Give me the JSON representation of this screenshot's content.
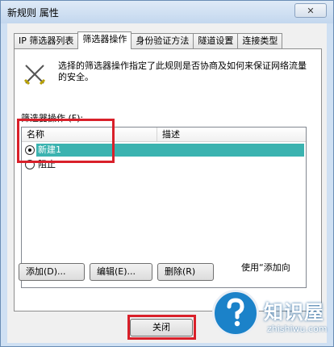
{
  "window": {
    "title": "新规则 属性",
    "close_glyph": "✕"
  },
  "tabs": [
    {
      "label": "IP 筛选器列表",
      "active": false
    },
    {
      "label": "筛选器操作",
      "active": true
    },
    {
      "label": "身份验证方法",
      "active": false
    },
    {
      "label": "隧道设置",
      "active": false
    },
    {
      "label": "连接类型",
      "active": false
    }
  ],
  "panel": {
    "icon": "crossed-swords-icon",
    "description": "选择的筛选器操作指定了此规则是否协商及如何来保证网络流量的安全。",
    "section_label": "筛选器操作 (F):"
  },
  "list": {
    "columns": [
      "名称",
      "描述"
    ],
    "rows": [
      {
        "name": "新建1",
        "description": "",
        "selected": true,
        "checked": true
      },
      {
        "name": "阻止",
        "description": "",
        "selected": false,
        "checked": false
      }
    ]
  },
  "buttons": {
    "add": "添加(D)...",
    "edit": "编辑(E)...",
    "delete": "删除(R)",
    "use_wizard": "使用“添加向",
    "close": "关闭"
  },
  "watermark": {
    "title": "知识屋",
    "subtitle": "zhishiwu.com"
  },
  "colors": {
    "selection": "#3bb3b0",
    "highlight_box": "#d9202a",
    "title_bar": "#cfe0f3",
    "watermark_blue": "#1b82c9"
  }
}
